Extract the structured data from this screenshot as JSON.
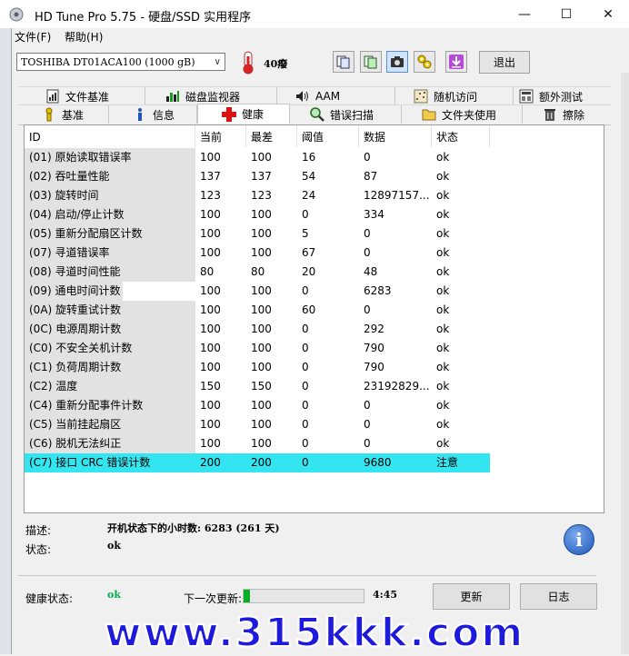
{
  "window": {
    "title": "HD Tune Pro 5.75 - 硬盘/SSD 实用程序",
    "min_glyph": "—",
    "max_glyph": "☐",
    "close_glyph": "✕"
  },
  "menu": {
    "file": "文件(F)",
    "help": "帮助(H)"
  },
  "toolbar": {
    "drive": "TOSHIBA DT01ACA100 (1000 gB)",
    "temperature": "40癈",
    "exit_label": "退出"
  },
  "tabs_row1": [
    {
      "label": "文件基准",
      "icon": "file-benchmark-icon"
    },
    {
      "label": "磁盘监视器",
      "icon": "disk-monitor-icon"
    },
    {
      "label": "AAM",
      "icon": "speaker-icon"
    },
    {
      "label": "随机访问",
      "icon": "random-access-icon"
    },
    {
      "label": "额外测试",
      "icon": "extra-tests-icon"
    }
  ],
  "tabs_row2": [
    {
      "label": "基准",
      "icon": "benchmark-icon"
    },
    {
      "label": "信息",
      "icon": "info-icon"
    },
    {
      "label": "健康",
      "icon": "health-cross-icon"
    },
    {
      "label": "错误扫描",
      "icon": "magnifier-icon"
    },
    {
      "label": "文件夹使用",
      "icon": "folder-icon"
    },
    {
      "label": "擦除",
      "icon": "trash-icon"
    }
  ],
  "table": {
    "headers": {
      "id": "ID",
      "current": "当前",
      "worst": "最差",
      "threshold": "阈值",
      "data": "数据",
      "status": "状态"
    },
    "rows": [
      {
        "id": "(01) 原始读取错误率",
        "current": "100",
        "worst": "100",
        "threshold": "16",
        "data": "0",
        "status": "ok"
      },
      {
        "id": "(02) 吞吐量性能",
        "current": "137",
        "worst": "137",
        "threshold": "54",
        "data": "87",
        "status": "ok"
      },
      {
        "id": "(03) 旋转时间",
        "current": "123",
        "worst": "123",
        "threshold": "24",
        "data": "12897157...",
        "status": "ok"
      },
      {
        "id": "(04) 启动/停止计数",
        "current": "100",
        "worst": "100",
        "threshold": "0",
        "data": "334",
        "status": "ok"
      },
      {
        "id": "(05) 重新分配扇区计数",
        "current": "100",
        "worst": "100",
        "threshold": "5",
        "data": "0",
        "status": "ok"
      },
      {
        "id": "(07) 寻道错误率",
        "current": "100",
        "worst": "100",
        "threshold": "67",
        "data": "0",
        "status": "ok"
      },
      {
        "id": "(08) 寻道时间性能",
        "current": "80",
        "worst": "80",
        "threshold": "20",
        "data": "48",
        "status": "ok"
      },
      {
        "id": "(09) 通电时间计数",
        "current": "100",
        "worst": "100",
        "threshold": "0",
        "data": "6283",
        "status": "ok"
      },
      {
        "id": "(0A) 旋转重试计数",
        "current": "100",
        "worst": "100",
        "threshold": "60",
        "data": "0",
        "status": "ok"
      },
      {
        "id": "(0C) 电源周期计数",
        "current": "100",
        "worst": "100",
        "threshold": "0",
        "data": "292",
        "status": "ok"
      },
      {
        "id": "(C0) 不安全关机计数",
        "current": "100",
        "worst": "100",
        "threshold": "0",
        "data": "790",
        "status": "ok"
      },
      {
        "id": "(C1) 负荷周期计数",
        "current": "100",
        "worst": "100",
        "threshold": "0",
        "data": "790",
        "status": "ok"
      },
      {
        "id": "(C2) 温度",
        "current": "150",
        "worst": "150",
        "threshold": "0",
        "data": "23192829...",
        "status": "ok"
      },
      {
        "id": "(C4) 重新分配事件计数",
        "current": "100",
        "worst": "100",
        "threshold": "0",
        "data": "0",
        "status": "ok"
      },
      {
        "id": "(C5) 当前挂起扇区",
        "current": "100",
        "worst": "100",
        "threshold": "0",
        "data": "0",
        "status": "ok"
      },
      {
        "id": "(C6) 脱机无法纠正",
        "current": "100",
        "worst": "100",
        "threshold": "0",
        "data": "0",
        "status": "ok"
      },
      {
        "id": "(C7) 接口 CRC 错误计数",
        "current": "200",
        "worst": "200",
        "threshold": "0",
        "data": "9680",
        "status": "注意"
      }
    ],
    "selected_row": 16
  },
  "details": {
    "description_label": "描述:",
    "description_value": "开机状态下的小时数: 6283 (261 天)",
    "status_label": "状态:",
    "status_value": "ok"
  },
  "footer": {
    "health_label": "健康状态:",
    "health_value": "ok",
    "next_update_label": "下一次更新:",
    "progress_fraction": 0.05,
    "countdown": "4:45",
    "refresh_label": "更新",
    "log_label": "日志"
  },
  "watermark": "www.315kkk.com",
  "colors": {
    "selected_row": "#33e5f0",
    "health_ok": "#00b050",
    "progress": "#06b025",
    "watermark": "#1d1adb"
  }
}
